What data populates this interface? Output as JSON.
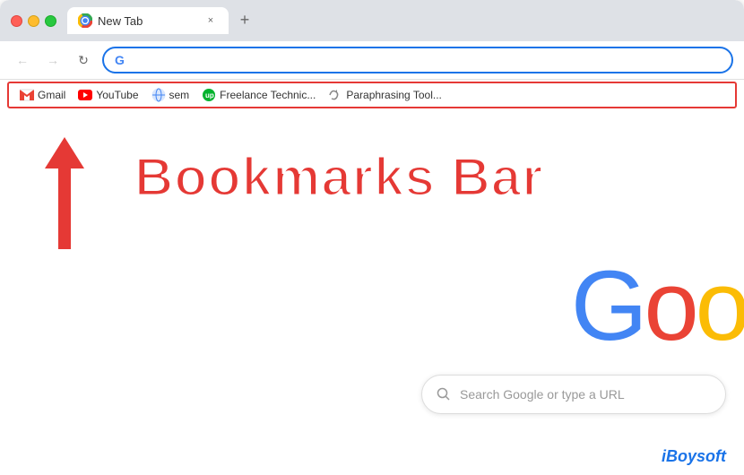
{
  "browser": {
    "title": "New Tab",
    "tab_close": "×",
    "tab_new": "+",
    "address": "G"
  },
  "nav": {
    "back": "←",
    "forward": "→",
    "refresh": "↻"
  },
  "bookmarks": [
    {
      "id": "gmail",
      "label": "Gmail",
      "icon": "M"
    },
    {
      "id": "youtube",
      "label": "YouTube",
      "icon": "▶"
    },
    {
      "id": "sem",
      "label": "sem",
      "icon": "🌐"
    },
    {
      "id": "freelance",
      "label": "Freelance Technic...",
      "icon": "up"
    },
    {
      "id": "paraphrasing",
      "label": "Paraphrasing Tool...",
      "icon": "✏"
    }
  ],
  "annotation": {
    "label": "Bookmarks Bar"
  },
  "google": {
    "partial": "Goog",
    "search_placeholder": "Search Google or type a URL"
  },
  "watermark": {
    "text": "iBoysoft"
  }
}
